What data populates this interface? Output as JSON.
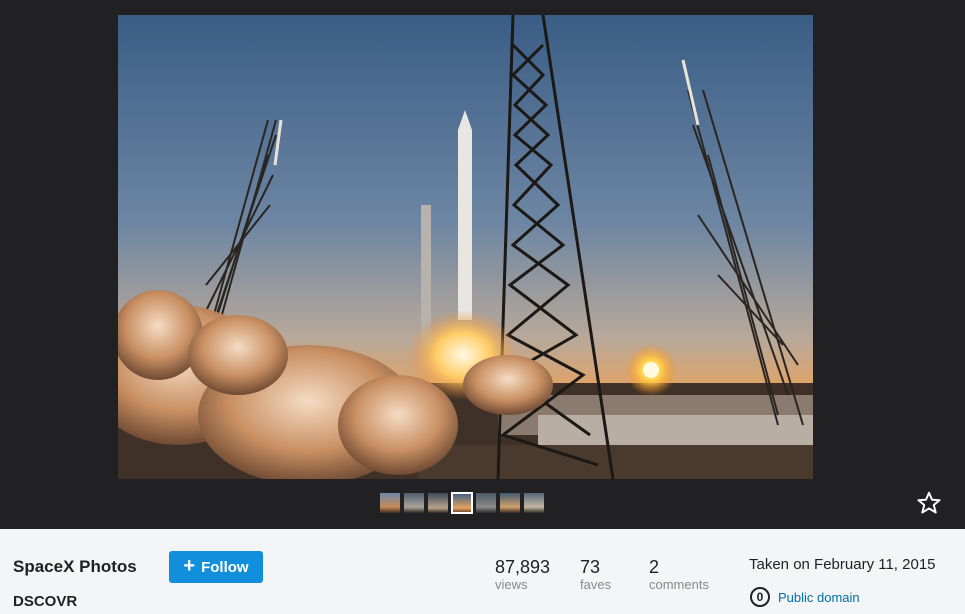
{
  "photo": {
    "alt": "Rocket launch at sunset",
    "thumbnails": [
      {
        "name": "thumb-1",
        "active": false
      },
      {
        "name": "thumb-2",
        "active": false
      },
      {
        "name": "thumb-3",
        "active": false
      },
      {
        "name": "thumb-4",
        "active": true
      },
      {
        "name": "thumb-5",
        "active": false
      },
      {
        "name": "thumb-6",
        "active": false
      },
      {
        "name": "thumb-7",
        "active": false
      }
    ],
    "favorite_icon": "star-outline-icon"
  },
  "owner": {
    "name": "SpaceX Photos",
    "follow_label": "Follow",
    "follow_icon": "plus-icon"
  },
  "photo_title": "DSCOVR",
  "stats": [
    {
      "value": "87,893",
      "label": "views"
    },
    {
      "value": "73",
      "label": "faves"
    },
    {
      "value": "2",
      "label": "comments"
    }
  ],
  "taken": "Taken on February 11, 2015",
  "license": {
    "icon": "public-domain-icon",
    "icon_glyph": "0",
    "label": "Public domain"
  },
  "colors": {
    "viewer_bg": "#212124",
    "info_bg": "#f3f5f6",
    "follow_bg": "#128fdc",
    "link": "#006dac"
  }
}
